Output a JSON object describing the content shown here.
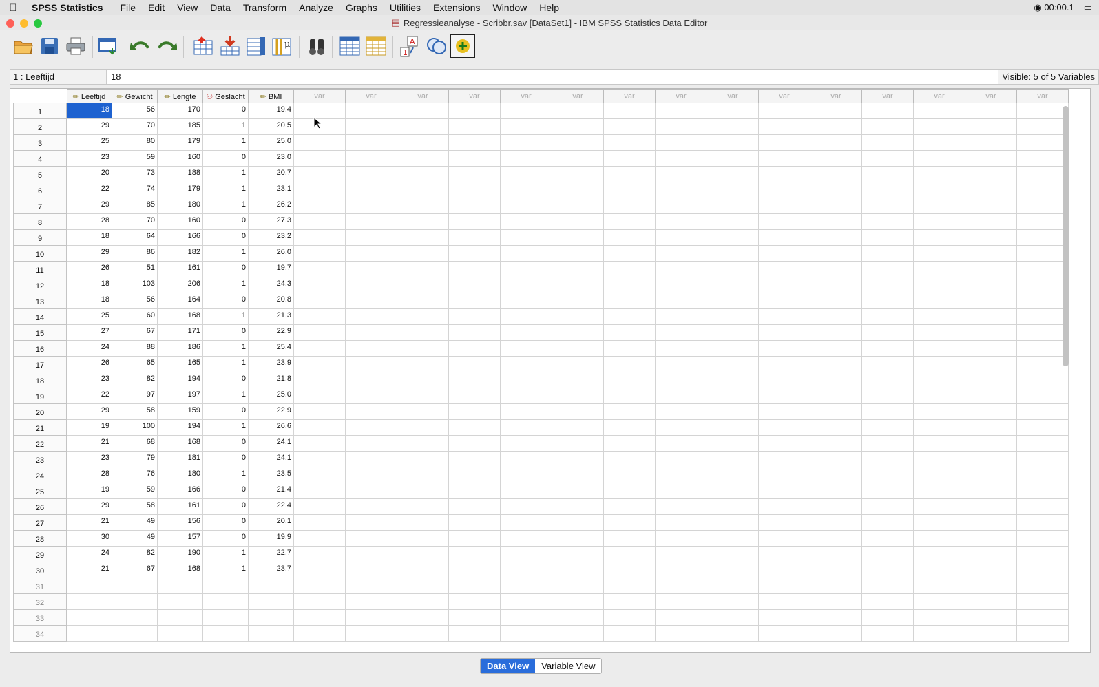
{
  "menubar": {
    "app_name": "SPSS Statistics",
    "items": [
      "File",
      "Edit",
      "View",
      "Data",
      "Transform",
      "Analyze",
      "Graphs",
      "Utilities",
      "Extensions",
      "Window",
      "Help"
    ],
    "timer": "00:00.1"
  },
  "window": {
    "title": "Regressieanalyse - Scribbr.sav [DataSet1] - IBM SPSS Statistics Data Editor"
  },
  "toolbar": {
    "icons": [
      "open-icon",
      "save-icon",
      "print-icon",
      "recall-dialog-icon",
      "undo-icon",
      "redo-icon",
      "goto-case-icon",
      "goto-variable-icon",
      "variables-icon",
      "run-descriptives-icon",
      "find-icon",
      "insert-cases-icon",
      "insert-variable-icon",
      "split-file-icon",
      "value-labels-icon",
      "use-sets-icon"
    ]
  },
  "cellbar": {
    "cell_name": "1 : Leeftijd",
    "cell_value": "18",
    "visible": "Visible: 5 of 5 Variables"
  },
  "grid": {
    "columns": [
      "Leeftijd",
      "Gewicht",
      "Lengte",
      "Geslacht",
      "BMI"
    ],
    "column_icons": [
      "scale-ruler-icon",
      "scale-ruler-icon",
      "scale-ruler-icon",
      "nominal-circles-icon",
      "scale-ruler-icon"
    ],
    "empty_column_label": "var",
    "empty_column_count": 15,
    "rows": [
      [
        "18",
        "56",
        "170",
        "0",
        "19.4"
      ],
      [
        "29",
        "70",
        "185",
        "1",
        "20.5"
      ],
      [
        "25",
        "80",
        "179",
        "1",
        "25.0"
      ],
      [
        "23",
        "59",
        "160",
        "0",
        "23.0"
      ],
      [
        "20",
        "73",
        "188",
        "1",
        "20.7"
      ],
      [
        "22",
        "74",
        "179",
        "1",
        "23.1"
      ],
      [
        "29",
        "85",
        "180",
        "1",
        "26.2"
      ],
      [
        "28",
        "70",
        "160",
        "0",
        "27.3"
      ],
      [
        "18",
        "64",
        "166",
        "0",
        "23.2"
      ],
      [
        "29",
        "86",
        "182",
        "1",
        "26.0"
      ],
      [
        "26",
        "51",
        "161",
        "0",
        "19.7"
      ],
      [
        "18",
        "103",
        "206",
        "1",
        "24.3"
      ],
      [
        "18",
        "56",
        "164",
        "0",
        "20.8"
      ],
      [
        "25",
        "60",
        "168",
        "1",
        "21.3"
      ],
      [
        "27",
        "67",
        "171",
        "0",
        "22.9"
      ],
      [
        "24",
        "88",
        "186",
        "1",
        "25.4"
      ],
      [
        "26",
        "65",
        "165",
        "1",
        "23.9"
      ],
      [
        "23",
        "82",
        "194",
        "0",
        "21.8"
      ],
      [
        "22",
        "97",
        "197",
        "1",
        "25.0"
      ],
      [
        "29",
        "58",
        "159",
        "0",
        "22.9"
      ],
      [
        "19",
        "100",
        "194",
        "1",
        "26.6"
      ],
      [
        "21",
        "68",
        "168",
        "0",
        "24.1"
      ],
      [
        "23",
        "79",
        "181",
        "0",
        "24.1"
      ],
      [
        "28",
        "76",
        "180",
        "1",
        "23.5"
      ],
      [
        "19",
        "59",
        "166",
        "0",
        "21.4"
      ],
      [
        "29",
        "58",
        "161",
        "0",
        "22.4"
      ],
      [
        "21",
        "49",
        "156",
        "0",
        "20.1"
      ],
      [
        "30",
        "49",
        "157",
        "0",
        "19.9"
      ],
      [
        "24",
        "82",
        "190",
        "1",
        "22.7"
      ],
      [
        "21",
        "67",
        "168",
        "1",
        "23.7"
      ]
    ],
    "empty_row_numbers": [
      "31",
      "32",
      "33",
      "34"
    ]
  },
  "tabs": {
    "data_view": "Data View",
    "variable_view": "Variable View"
  }
}
